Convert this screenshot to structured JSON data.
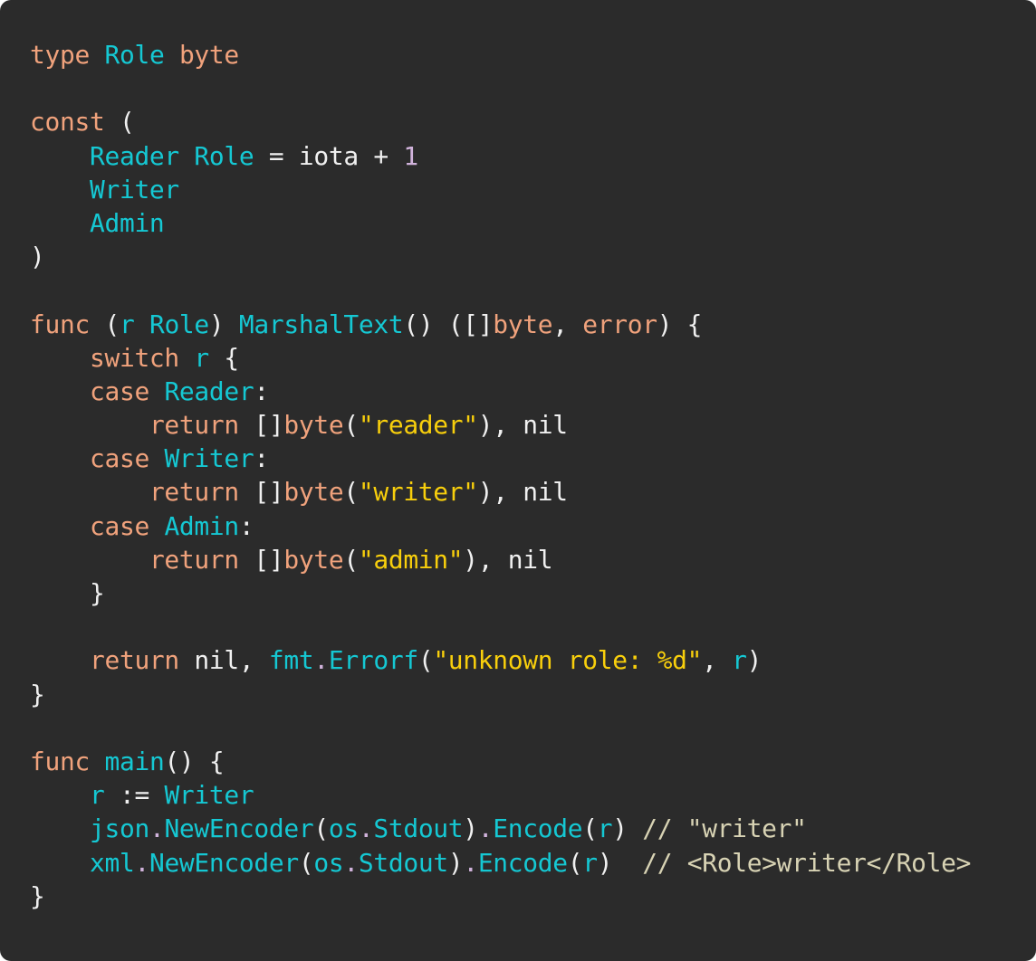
{
  "language": "go",
  "colors": {
    "background": "#2b2b2b",
    "keyword": "#f0a27c",
    "identifier": "#15c8d3",
    "string": "#f8cf0c",
    "number": "#d1b3dc",
    "punctuation": "#f0f0f0",
    "comment": "#d8d3b4"
  },
  "lines": [
    [
      {
        "t": "type",
        "k": "kw"
      },
      {
        "t": " ",
        "k": "plain"
      },
      {
        "t": "Role",
        "k": "id"
      },
      {
        "t": " ",
        "k": "plain"
      },
      {
        "t": "byte",
        "k": "kw"
      }
    ],
    [],
    [
      {
        "t": "const",
        "k": "kw"
      },
      {
        "t": " (",
        "k": "pun"
      }
    ],
    [
      {
        "t": "    ",
        "k": "plain"
      },
      {
        "t": "Reader",
        "k": "id"
      },
      {
        "t": " ",
        "k": "plain"
      },
      {
        "t": "Role",
        "k": "id"
      },
      {
        "t": " = iota + ",
        "k": "plain"
      },
      {
        "t": "1",
        "k": "num"
      }
    ],
    [
      {
        "t": "    ",
        "k": "plain"
      },
      {
        "t": "Writer",
        "k": "id"
      }
    ],
    [
      {
        "t": "    ",
        "k": "plain"
      },
      {
        "t": "Admin",
        "k": "id"
      }
    ],
    [
      {
        "t": ")",
        "k": "pun"
      }
    ],
    [],
    [
      {
        "t": "func",
        "k": "kw"
      },
      {
        "t": " (",
        "k": "pun"
      },
      {
        "t": "r",
        "k": "id"
      },
      {
        "t": " ",
        "k": "plain"
      },
      {
        "t": "Role",
        "k": "id"
      },
      {
        "t": ") ",
        "k": "pun"
      },
      {
        "t": "MarshalText",
        "k": "id"
      },
      {
        "t": "() ([]",
        "k": "pun"
      },
      {
        "t": "byte",
        "k": "kw"
      },
      {
        "t": ", ",
        "k": "pun"
      },
      {
        "t": "error",
        "k": "kw"
      },
      {
        "t": ") {",
        "k": "pun"
      }
    ],
    [
      {
        "t": "    ",
        "k": "plain"
      },
      {
        "t": "switch",
        "k": "kw"
      },
      {
        "t": " ",
        "k": "plain"
      },
      {
        "t": "r",
        "k": "id"
      },
      {
        "t": " {",
        "k": "pun"
      }
    ],
    [
      {
        "t": "    ",
        "k": "plain"
      },
      {
        "t": "case",
        "k": "kw"
      },
      {
        "t": " ",
        "k": "plain"
      },
      {
        "t": "Reader",
        "k": "id"
      },
      {
        "t": ":",
        "k": "pun"
      }
    ],
    [
      {
        "t": "        ",
        "k": "plain"
      },
      {
        "t": "return",
        "k": "kw"
      },
      {
        "t": " []",
        "k": "pun"
      },
      {
        "t": "byte",
        "k": "kw"
      },
      {
        "t": "(",
        "k": "pun"
      },
      {
        "t": "\"reader\"",
        "k": "str"
      },
      {
        "t": "), nil",
        "k": "pun"
      }
    ],
    [
      {
        "t": "    ",
        "k": "plain"
      },
      {
        "t": "case",
        "k": "kw"
      },
      {
        "t": " ",
        "k": "plain"
      },
      {
        "t": "Writer",
        "k": "id"
      },
      {
        "t": ":",
        "k": "pun"
      }
    ],
    [
      {
        "t": "        ",
        "k": "plain"
      },
      {
        "t": "return",
        "k": "kw"
      },
      {
        "t": " []",
        "k": "pun"
      },
      {
        "t": "byte",
        "k": "kw"
      },
      {
        "t": "(",
        "k": "pun"
      },
      {
        "t": "\"writer\"",
        "k": "str"
      },
      {
        "t": "), nil",
        "k": "pun"
      }
    ],
    [
      {
        "t": "    ",
        "k": "plain"
      },
      {
        "t": "case",
        "k": "kw"
      },
      {
        "t": " ",
        "k": "plain"
      },
      {
        "t": "Admin",
        "k": "id"
      },
      {
        "t": ":",
        "k": "pun"
      }
    ],
    [
      {
        "t": "        ",
        "k": "plain"
      },
      {
        "t": "return",
        "k": "kw"
      },
      {
        "t": " []",
        "k": "pun"
      },
      {
        "t": "byte",
        "k": "kw"
      },
      {
        "t": "(",
        "k": "pun"
      },
      {
        "t": "\"admin\"",
        "k": "str"
      },
      {
        "t": "), nil",
        "k": "pun"
      }
    ],
    [
      {
        "t": "    }",
        "k": "pun"
      }
    ],
    [],
    [
      {
        "t": "    ",
        "k": "plain"
      },
      {
        "t": "return",
        "k": "kw"
      },
      {
        "t": " nil, ",
        "k": "pun"
      },
      {
        "t": "fmt",
        "k": "id"
      },
      {
        "t": ".",
        "k": "dot"
      },
      {
        "t": "Errorf",
        "k": "id"
      },
      {
        "t": "(",
        "k": "pun"
      },
      {
        "t": "\"unknown role: %d\"",
        "k": "str"
      },
      {
        "t": ", ",
        "k": "pun"
      },
      {
        "t": "r",
        "k": "id"
      },
      {
        "t": ")",
        "k": "pun"
      }
    ],
    [
      {
        "t": "}",
        "k": "pun"
      }
    ],
    [],
    [
      {
        "t": "func",
        "k": "kw"
      },
      {
        "t": " ",
        "k": "plain"
      },
      {
        "t": "main",
        "k": "id"
      },
      {
        "t": "() {",
        "k": "pun"
      }
    ],
    [
      {
        "t": "    ",
        "k": "plain"
      },
      {
        "t": "r",
        "k": "id"
      },
      {
        "t": " := ",
        "k": "pun"
      },
      {
        "t": "Writer",
        "k": "id"
      }
    ],
    [
      {
        "t": "    ",
        "k": "plain"
      },
      {
        "t": "json",
        "k": "id"
      },
      {
        "t": ".",
        "k": "dot"
      },
      {
        "t": "NewEncoder",
        "k": "id"
      },
      {
        "t": "(",
        "k": "pun"
      },
      {
        "t": "os",
        "k": "id"
      },
      {
        "t": ".",
        "k": "dot"
      },
      {
        "t": "Stdout",
        "k": "id"
      },
      {
        "t": ")",
        "k": "pun"
      },
      {
        "t": ".",
        "k": "dot"
      },
      {
        "t": "Encode",
        "k": "id"
      },
      {
        "t": "(",
        "k": "pun"
      },
      {
        "t": "r",
        "k": "id"
      },
      {
        "t": ") ",
        "k": "pun"
      },
      {
        "t": "// \"writer\"",
        "k": "cmt"
      }
    ],
    [
      {
        "t": "    ",
        "k": "plain"
      },
      {
        "t": "xml",
        "k": "id"
      },
      {
        "t": ".",
        "k": "dot"
      },
      {
        "t": "NewEncoder",
        "k": "id"
      },
      {
        "t": "(",
        "k": "pun"
      },
      {
        "t": "os",
        "k": "id"
      },
      {
        "t": ".",
        "k": "dot"
      },
      {
        "t": "Stdout",
        "k": "id"
      },
      {
        "t": ")",
        "k": "pun"
      },
      {
        "t": ".",
        "k": "dot"
      },
      {
        "t": "Encode",
        "k": "id"
      },
      {
        "t": "(",
        "k": "pun"
      },
      {
        "t": "r",
        "k": "id"
      },
      {
        "t": ")  ",
        "k": "pun"
      },
      {
        "t": "// <Role>writer</Role>",
        "k": "cmt"
      }
    ],
    [
      {
        "t": "}",
        "k": "pun"
      }
    ]
  ]
}
